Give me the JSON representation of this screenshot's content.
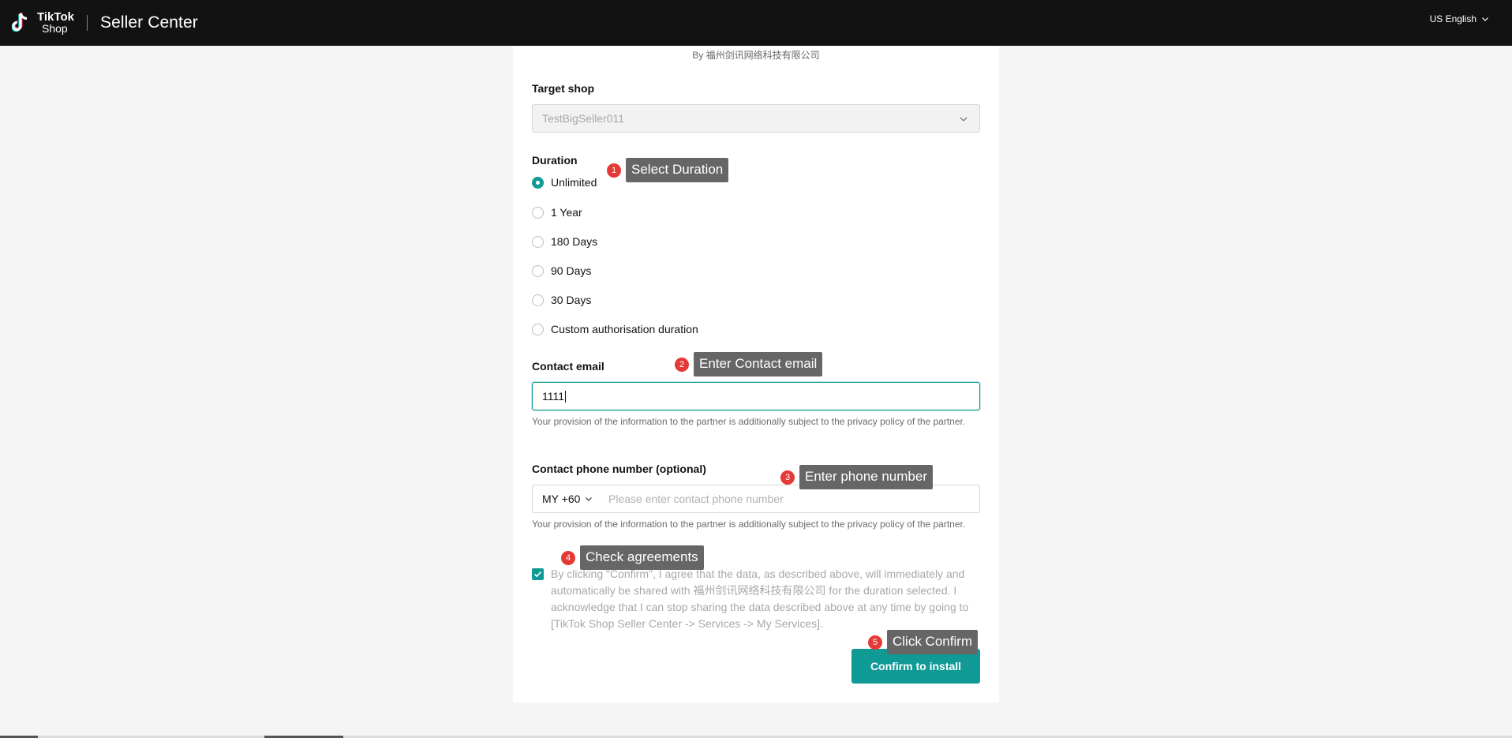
{
  "header": {
    "logo_line1": "TikTok",
    "logo_line2": "Shop",
    "app_title": "Seller Center",
    "language": "US English"
  },
  "form": {
    "byline": "By 福州剑讯网络科技有限公司",
    "target_shop_label": "Target shop",
    "target_shop_value": "TestBigSeller011",
    "duration_label": "Duration",
    "duration_options": [
      {
        "label": "Unlimited",
        "selected": true
      },
      {
        "label": "1 Year",
        "selected": false
      },
      {
        "label": "180 Days",
        "selected": false
      },
      {
        "label": "90 Days",
        "selected": false
      },
      {
        "label": "30 Days",
        "selected": false
      },
      {
        "label": "Custom authorisation duration",
        "selected": false
      }
    ],
    "email_label": "Contact email",
    "email_value": "1111",
    "email_hint": "Your provision of the information to the partner is additionally subject to the privacy policy of the partner.",
    "phone_label": "Contact phone number (optional)",
    "phone_prefix": "MY +60",
    "phone_placeholder": "Please enter contact phone number",
    "phone_hint": "Your provision of the information to the partner is additionally subject to the privacy policy of the partner.",
    "agreement_checked": true,
    "agreement_text": "By clicking \"Confirm\", I agree that the data, as described above, will immediately and automatically be shared with 福州剑讯网络科技有限公司 for the duration selected. I acknowledge that I can stop sharing the data described above at any time by going to [TikTok Shop Seller Center -> Services -> My Services].",
    "confirm_button": "Confirm to install"
  },
  "annotations": [
    {
      "number": "1",
      "text": "Select Duration"
    },
    {
      "number": "2",
      "text": "Enter Contact email"
    },
    {
      "number": "3",
      "text": "Enter phone number"
    },
    {
      "number": "4",
      "text": "Check agreements"
    },
    {
      "number": "5",
      "text": "Click Confirm"
    }
  ],
  "colors": {
    "accent": "#0f9a96",
    "header_bg": "#121212",
    "annotation_dot": "#e53935",
    "annotation_tip": "#666666"
  }
}
